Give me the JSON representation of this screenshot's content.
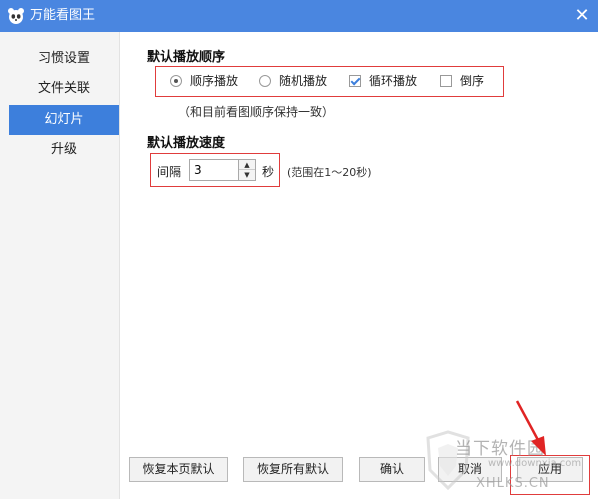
{
  "window": {
    "title": "万能看图王",
    "close_icon": "close-icon",
    "app_icon": "panda-logo-icon"
  },
  "sidebar": {
    "items": [
      {
        "label": "习惯设置",
        "active": false
      },
      {
        "label": "文件关联",
        "active": false
      },
      {
        "label": "幻灯片",
        "active": true
      },
      {
        "label": "升级",
        "active": false
      }
    ]
  },
  "playback_order": {
    "title": "默认播放顺序",
    "options": [
      {
        "label": "顺序播放",
        "type": "radio",
        "checked": true
      },
      {
        "label": "随机播放",
        "type": "radio",
        "checked": false
      },
      {
        "label": "循环播放",
        "type": "checkbox",
        "checked": true
      },
      {
        "label": "倒序",
        "type": "checkbox",
        "checked": false
      }
    ],
    "note": "（和目前看图顺序保持一致）"
  },
  "playback_speed": {
    "title": "默认播放速度",
    "interval_label": "间隔",
    "interval_value": "3",
    "unit": "秒",
    "range_note": "(范围在1～20秒)"
  },
  "buttons": {
    "restore_page": "恢复本页默认",
    "restore_all": "恢复所有默认",
    "confirm": "确认",
    "cancel": "取消",
    "apply": "应用"
  },
  "watermark": {
    "line1": "当下软件园",
    "line2": "www.downxia.com",
    "line3": "XHLKS.CN"
  },
  "colors": {
    "titlebar": "#4a86e0",
    "active_item": "#3d7fdc",
    "highlight_box": "#e03c3c"
  }
}
